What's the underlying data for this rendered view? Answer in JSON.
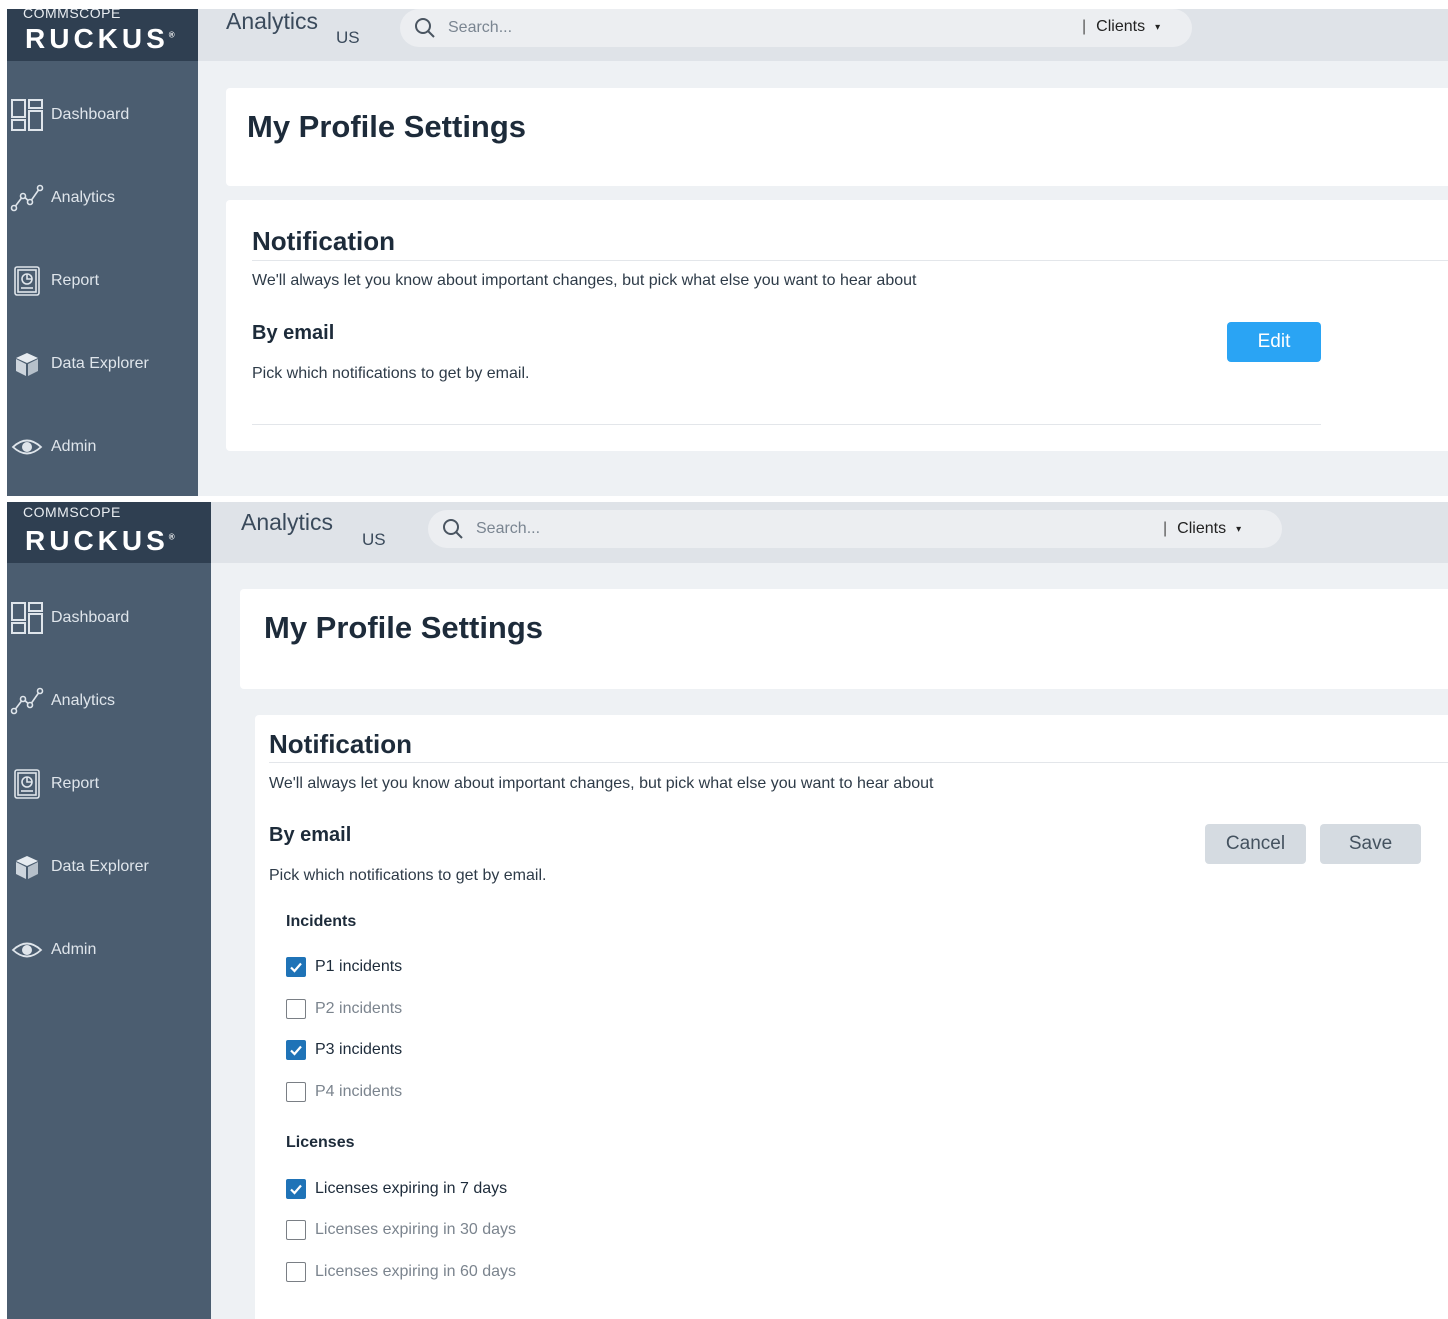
{
  "brand": {
    "company": "COMMSCOPE",
    "product": "RUCKUS",
    "reg": "®"
  },
  "header": {
    "app_title": "Analytics",
    "region": "US",
    "search_placeholder": "Search...",
    "scope_separator": "|",
    "scope_label": "Clients",
    "scope_caret": "▾"
  },
  "sidebar": {
    "items": [
      {
        "label": "Dashboard",
        "icon": "dashboard-icon"
      },
      {
        "label": "Analytics",
        "icon": "analytics-icon"
      },
      {
        "label": "Report",
        "icon": "report-icon"
      },
      {
        "label": "Data Explorer",
        "icon": "data-explorer-icon"
      },
      {
        "label": "Admin",
        "icon": "eye-icon"
      }
    ]
  },
  "page": {
    "title": "My Profile Settings"
  },
  "notification": {
    "title": "Notification",
    "description": "We'll always let you know about important changes, but pick what else you want to hear about",
    "by_email_title": "By email",
    "by_email_description": "Pick which notifications to get by email."
  },
  "view_state": {
    "edit_label": "Edit"
  },
  "edit_state": {
    "cancel_label": "Cancel",
    "save_label": "Save",
    "groups": [
      {
        "label": "Incidents",
        "options": [
          {
            "label": "P1 incidents",
            "checked": true
          },
          {
            "label": "P2 incidents",
            "checked": false
          },
          {
            "label": "P3 incidents",
            "checked": true
          },
          {
            "label": "P4 incidents",
            "checked": false
          }
        ]
      },
      {
        "label": "Licenses",
        "options": [
          {
            "label": "Licenses expiring in 7 days",
            "checked": true
          },
          {
            "label": "Licenses expiring in 30 days",
            "checked": false
          },
          {
            "label": "Licenses expiring in 60 days",
            "checked": false
          }
        ]
      }
    ]
  },
  "colors": {
    "sidebar": "#4b5d70",
    "brand_bar": "#2f3f51",
    "primary_button": "#2aa4f4",
    "checkbox_checked": "#1f73b7"
  }
}
